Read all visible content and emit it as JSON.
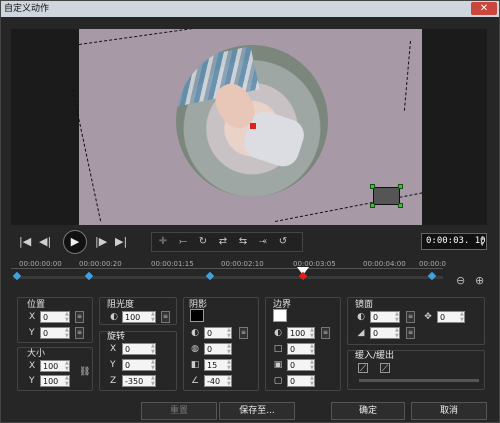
{
  "window": {
    "title": "自定义动作"
  },
  "timeline": {
    "timecode": "0:00:03. 10",
    "tick_labels": [
      "00:00:00:00",
      "00:00:00:20",
      "00:00:01:15",
      "00:00:02:10",
      "00:00:03:05",
      "00:00:04:00",
      "00:00:0"
    ]
  },
  "position": {
    "title": "位置",
    "x_label": "X",
    "y_label": "Y",
    "x": "0",
    "y": "0"
  },
  "size": {
    "title": "大小",
    "x_label": "X",
    "y_label": "Y",
    "x": "100",
    "y": "100"
  },
  "opacity": {
    "title": "阻光度",
    "value": "100"
  },
  "rotation": {
    "title": "旋转",
    "x_label": "X",
    "y_label": "Y",
    "z_label": "Z",
    "x": "0",
    "y": "0",
    "z": "-350"
  },
  "shadow": {
    "title": "阴影",
    "color": "#000000",
    "v1": "0",
    "v2": "0",
    "v3": "15",
    "v4": "-40",
    "v5": "10"
  },
  "border": {
    "title": "边界",
    "color": "#ffffff",
    "v1": "100",
    "v2": "0",
    "v3": "0",
    "v4": "0"
  },
  "mirror": {
    "title": "镜面",
    "v1": "0",
    "v2": "0",
    "v3": "0"
  },
  "fade": {
    "title": "缓入/缓出"
  },
  "footer": {
    "reset": "重置",
    "save_to": "保存至...",
    "ok": "确定",
    "cancel": "取消"
  },
  "colors": {
    "accent_keyframe": "#3da3e0",
    "current_keyframe": "#e02020",
    "canvas_bg": "#a79aa6"
  }
}
